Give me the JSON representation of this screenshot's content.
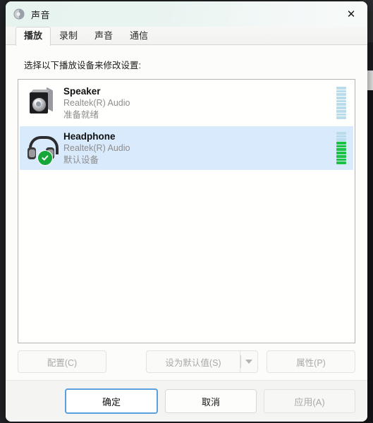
{
  "window": {
    "title": "声音",
    "title_icon": "speaker-icon",
    "close_label": "✕"
  },
  "tabs": [
    {
      "label": "播放",
      "active": true
    },
    {
      "label": "录制",
      "active": false
    },
    {
      "label": "声音",
      "active": false
    },
    {
      "label": "通信",
      "active": false
    }
  ],
  "main": {
    "prompt": "选择以下播放设备来修改设置:",
    "devices": [
      {
        "icon": "speaker-icon",
        "name": "Speaker",
        "driver": "Realtek(R) Audio",
        "status": "准备就绪",
        "selected": false,
        "default_device": false,
        "meter_total": 10,
        "meter_active": 0
      },
      {
        "icon": "headphone-icon",
        "name": "Headphone",
        "driver": "Realtek(R) Audio",
        "status": "默认设备",
        "selected": true,
        "default_device": true,
        "meter_total": 10,
        "meter_active": 7
      }
    ]
  },
  "actions": {
    "configure": {
      "label": "配置(C)",
      "disabled": true
    },
    "set_default": {
      "label": "设为默认值(S)",
      "disabled": true,
      "arrow_icon": "chevron-down-icon"
    },
    "properties": {
      "label": "属性(P)",
      "disabled": true
    }
  },
  "footer": {
    "ok": {
      "label": "确定",
      "default": true,
      "disabled": false
    },
    "cancel": {
      "label": "取消",
      "default": false,
      "disabled": false
    },
    "apply": {
      "label": "应用(A)",
      "default": false,
      "disabled": true
    }
  },
  "colors": {
    "titlebar_tint": "#e6f3ee",
    "selection": "#d9eafc",
    "meter_on": "#1bc246",
    "meter_off": "#b9dcec",
    "default_badge": "#17a63a",
    "focus_border": "#5aa0dd"
  }
}
